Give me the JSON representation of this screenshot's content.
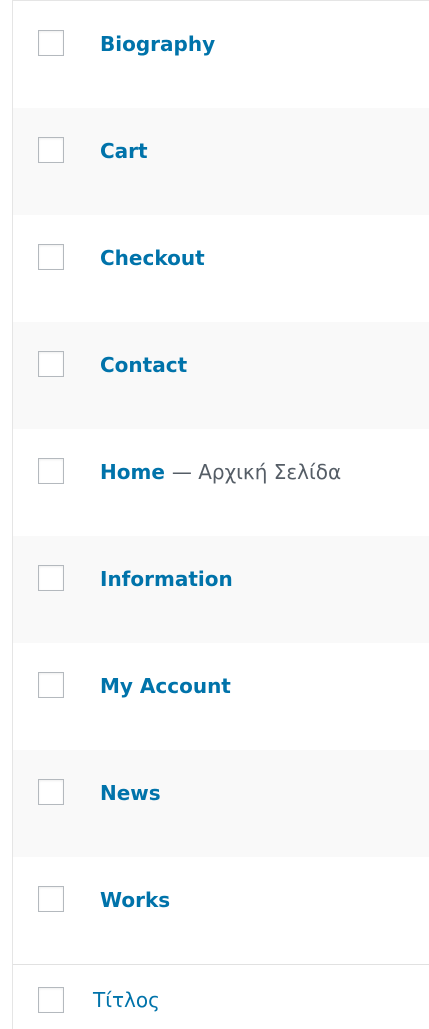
{
  "rows": [
    {
      "title": "Biography"
    },
    {
      "title": "Cart"
    },
    {
      "title": "Checkout"
    },
    {
      "title": "Contact"
    },
    {
      "title": "Home",
      "state": "— Αρχική Σελίδα"
    },
    {
      "title": "Information"
    },
    {
      "title": "My Account"
    },
    {
      "title": "News"
    },
    {
      "title": "Works"
    }
  ],
  "footer": {
    "column_label": "Τίτλος"
  },
  "colors": {
    "link": "#0073aa",
    "alt_row": "#f9f9f9",
    "border": "#e5e5e5"
  }
}
